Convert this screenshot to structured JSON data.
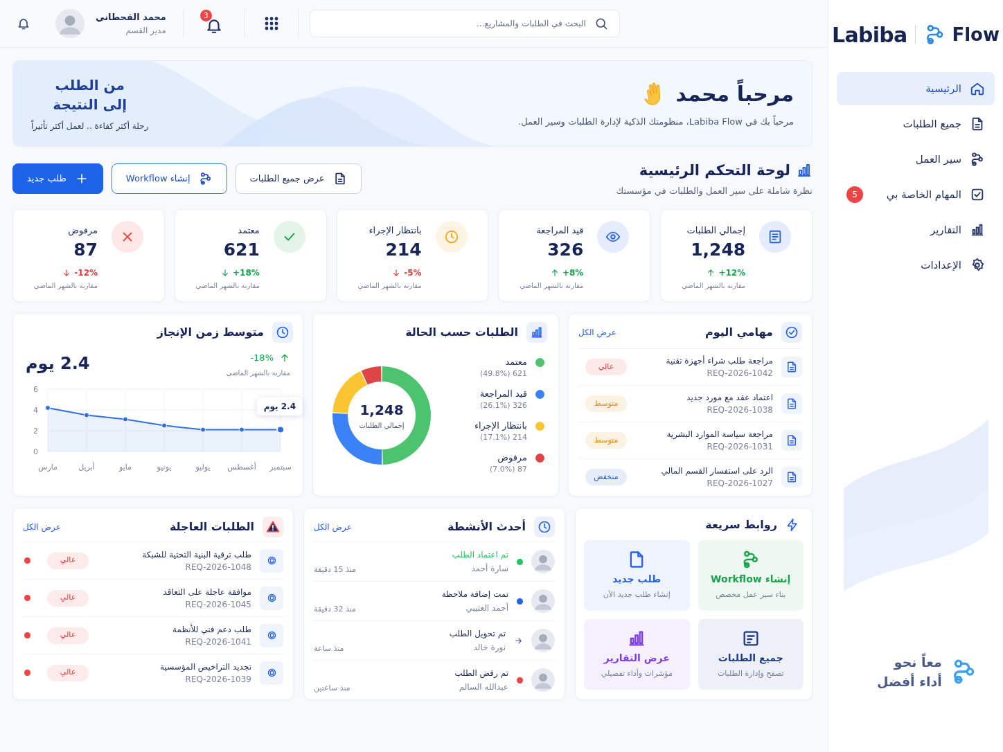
{
  "sidebar": {
    "logo": {
      "brand": "Labiba",
      "product": "Flow"
    },
    "items": [
      {
        "label": "الرئيسية",
        "selected": true
      },
      {
        "label": "جميع الطلبات",
        "selected": false
      },
      {
        "label": "سير العمل",
        "selected": false
      },
      {
        "label": "المهام الخاصة بي",
        "selected": false,
        "badge": "5"
      },
      {
        "label": "التقارير",
        "selected": false
      },
      {
        "label": "الإعدادات",
        "selected": false
      }
    ],
    "tagline": [
      "معاً نحو",
      "أداء أفضل"
    ]
  },
  "top_bar": {
    "search": {
      "placeholder": "البحث في الطلبات والمشاريع..."
    },
    "notifications_badge": "3",
    "user": {
      "name": "محمد القحطاني",
      "role": "مدير القسم"
    }
  },
  "hero": {
    "title": "مرحباً محمد",
    "subtitle": "مرحباً بك في Labiba Flow، منظومتك الذكية لإدارة الطلبات وسير العمل.",
    "slogan": [
      "من الطلب",
      "إلى النتيجة"
    ],
    "slogan_caption": "رحلة أكثر كفاءة .. لعمل أكثر تأثيراً"
  },
  "dashboard": {
    "title": "لوحة التحكم الرئيسية",
    "subtitle": "نظرة شاملة على سير العمل والطلبات في مؤسستك",
    "buttons": [
      {
        "label": "عرض جميع الطلبات",
        "kind": "outline"
      },
      {
        "label": "إنشاء Workflow",
        "kind": "outline_blue"
      },
      {
        "label": "طلب جديد",
        "kind": "primary"
      }
    ]
  },
  "kpis": [
    {
      "label": "إجمالي الطلبات",
      "value": "1,248",
      "change": "+12%",
      "rising": true,
      "positive": true,
      "comparison": "مقارنة بالشهر الماضي",
      "color": "#2563eb"
    },
    {
      "label": "قيد المراجعة",
      "value": "326",
      "change": "+8%",
      "rising": true,
      "positive": true,
      "comparison": "مقارنة بالشهر الماضي",
      "color": "#2563eb"
    },
    {
      "label": "بانتظار الإجراء",
      "value": "214",
      "change": "-5%",
      "rising": false,
      "positive": false,
      "comparison": "مقارنة بالشهر الماضي",
      "color": "#f5a524"
    },
    {
      "label": "معتمد",
      "value": "621",
      "change": "+18%",
      "rising": false,
      "positive": true,
      "comparison": "مقارنة بالشهر الماضي",
      "color": "#16a34a"
    },
    {
      "label": "مرفوض",
      "value": "87",
      "change": "-12%",
      "rising": false,
      "positive": false,
      "comparison": "مقارنة بالشهر الماضي",
      "color": "#ef4444"
    }
  ],
  "today_tasks": {
    "title": "مهامي اليوم",
    "view_all": "عرض الكل",
    "items": [
      {
        "title": "مراجعة طلب شراء أجهزة تقنية",
        "id": "REQ-2026-1042",
        "priority": "عالي",
        "color": "#e53935"
      },
      {
        "title": "اعتماد عقد مع مورد جديد",
        "id": "REQ-2026-1038",
        "priority": "متوسط",
        "color": "#e88a00"
      },
      {
        "title": "مراجعة سياسة الموارد البشرية",
        "id": "REQ-2026-1031",
        "priority": "متوسط",
        "color": "#e88a00"
      },
      {
        "title": "الرد على استفسار القسم المالي",
        "id": "REQ-2026-1027",
        "priority": "منخفض",
        "color": "#2456c9"
      }
    ]
  },
  "status_breakdown": {
    "title": "الطلبات حسب الحالة",
    "center_value": "1,248",
    "center_label": "إجمالي الطلبات",
    "legend": [
      {
        "label": "معتمد",
        "detail": "621 (49.8%)",
        "color": "#4cc36f"
      },
      {
        "label": "قيد المراجعة",
        "detail": "326 (26.1%)",
        "color": "#3b82f6"
      },
      {
        "label": "بانتظار الإجراء",
        "detail": "214 (17.1%)",
        "color": "#fbc531"
      },
      {
        "label": "مرفوض",
        "detail": "87 (7.0%)",
        "color": "#e04545"
      }
    ],
    "chart_data": {
      "type": "donut",
      "values": [
        49.8,
        26.1,
        17.1,
        7.0
      ]
    }
  },
  "completion_time": {
    "title": "متوسط زمن الإنجاز",
    "value": "2.4 يوم",
    "change": "-18%",
    "rising": true,
    "positive": true,
    "comparison": "مقارنة بالشهر الماضي",
    "tooltip": "2.4 يوم",
    "chart_data": {
      "type": "area",
      "categories": [
        "مارس",
        "أبريل",
        "مايو",
        "يونيو",
        "يوليو",
        "أغسطس",
        "سبتمبر"
      ],
      "series": [
        {
          "color": "#2f6fe0",
          "values": [
            4.2,
            3.5,
            3.1,
            2.5,
            2.1,
            2.1,
            2.1
          ]
        }
      ],
      "ylim": [
        0,
        6
      ],
      "yticks": [
        0,
        2,
        4,
        6
      ],
      "grid": true
    }
  },
  "quick_links": {
    "title": "روابط سريعة",
    "items": [
      {
        "title": "إنشاء Workflow",
        "subtitle": "بناء سير عمل مخصص",
        "color": "#16a34a"
      },
      {
        "title": "طلب جديد",
        "subtitle": "إنشاء طلب جديد الآن",
        "color": "#2563eb"
      },
      {
        "title": "جميع الطلبات",
        "subtitle": "تصفح وإدارة الطلبات",
        "color": "#1e3a8a"
      },
      {
        "title": "عرض التقارير",
        "subtitle": "مؤشرات وأداء تفصيلي",
        "color": "#7c3aed"
      }
    ]
  },
  "activities": {
    "title": "أحدث الأنشطة",
    "view_all": "عرض الكل",
    "items": [
      {
        "action": "تم اعتماد الطلب",
        "person": "سارة أحمد",
        "time": "منذ 15 دقيقة",
        "kind": "dot",
        "color": "#22c55e"
      },
      {
        "action": "تمت إضافة ملاحظة",
        "person": "أحمد العتيبي",
        "time": "منذ 32 دقيقة",
        "kind": "dot",
        "color": "#2563eb"
      },
      {
        "action": "تم تحويل الطلب",
        "person": "نورة خالد",
        "time": "منذ ساعة",
        "kind": "arrow",
        "color": "#2563eb"
      },
      {
        "action": "تم رفض الطلب",
        "person": "عبدالله السالم",
        "time": "منذ ساعتين",
        "kind": "dot",
        "color": "#ef4444"
      }
    ]
  },
  "urgent_requests": {
    "title": "الطلبات العاجلة",
    "view_all": "عرض الكل",
    "items": [
      {
        "title": "طلب ترقية البنية التحتية للشبكة",
        "id": "REQ-2026-1048",
        "priority": "عالي"
      },
      {
        "title": "موافقة عاجلة على التعاقد",
        "id": "REQ-2026-1045",
        "priority": "عالي"
      },
      {
        "title": "طلب دعم فني للأنظمة",
        "id": "REQ-2026-1041",
        "priority": "عالي"
      },
      {
        "title": "تجديد التراخيص المؤسسية",
        "id": "REQ-2026-1039",
        "priority": "عالي"
      }
    ]
  }
}
